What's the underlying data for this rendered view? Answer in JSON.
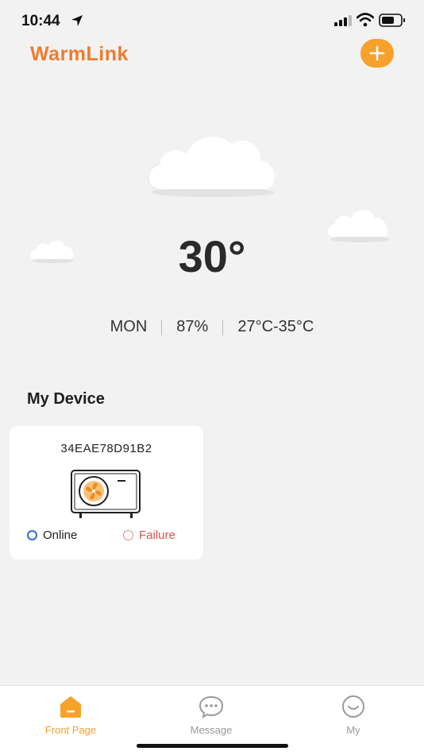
{
  "status_bar": {
    "time": "10:44"
  },
  "header": {
    "app_name": "WarmLink",
    "add_icon": "plus-icon"
  },
  "weather": {
    "temperature": "30°",
    "day": "MON",
    "humidity": "87%",
    "range": "27°C-35°C"
  },
  "devices_section": {
    "title": "My Device"
  },
  "device": {
    "id": "34EAE78D91B2",
    "online_label": "Online",
    "failure_label": "Failure"
  },
  "nav": {
    "items": [
      {
        "label": "Front Page",
        "icon": "home-icon",
        "active": true
      },
      {
        "label": "Message",
        "icon": "message-icon",
        "active": false
      },
      {
        "label": "My",
        "icon": "profile-icon",
        "active": false
      }
    ]
  },
  "colors": {
    "accent": "#f6a12a",
    "logo": "#f07b2d",
    "online": "#2d6fd6",
    "failure": "#d9534f"
  }
}
